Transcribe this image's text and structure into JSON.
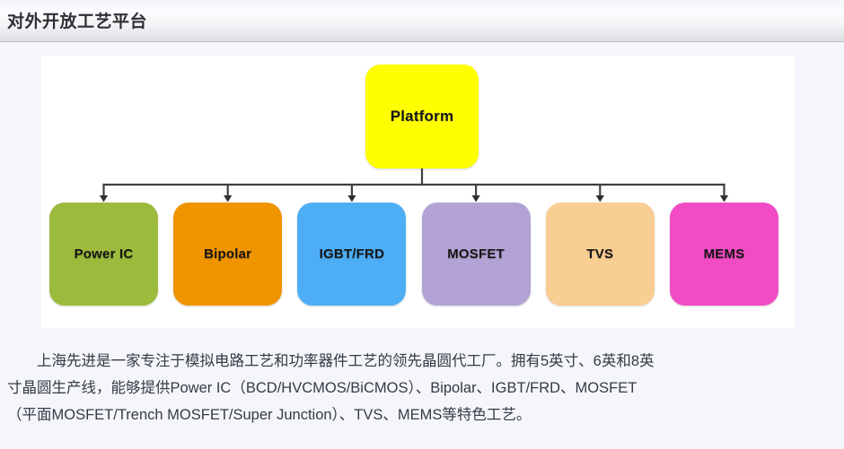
{
  "header": {
    "title": "对外开放工艺平台"
  },
  "diagram": {
    "root": {
      "label": "Platform",
      "color": "#ffff00"
    },
    "nodes": [
      {
        "label": "Power IC",
        "color": "#9cba3c"
      },
      {
        "label": "Bipolar",
        "color": "#f09400"
      },
      {
        "label": "IGBT/FRD",
        "color": "#4daef5"
      },
      {
        "label": "MOSFET",
        "color": "#b3a3d4"
      },
      {
        "label": "TVS",
        "color": "#f8ce92"
      },
      {
        "label": "MEMS",
        "color": "#f14cc4"
      }
    ],
    "connector_color": "#404040",
    "panel_background": "#ffffff"
  },
  "description": {
    "lines": [
      "上海先进是一家专注于模拟电路工艺和功率器件工艺的领先晶圆代工厂。拥有5英寸、6英和8英",
      "寸晶圆生产线，能够提供Power IC（BCD/HVCMOS/BiCMOS）、Bipolar、IGBT/FRD、MOSFET",
      "（平面MOSFET/Trench MOSFET/Super Junction）、TVS、MEMS等特色工艺。"
    ]
  },
  "page": {
    "background": "#f5f6fb"
  }
}
